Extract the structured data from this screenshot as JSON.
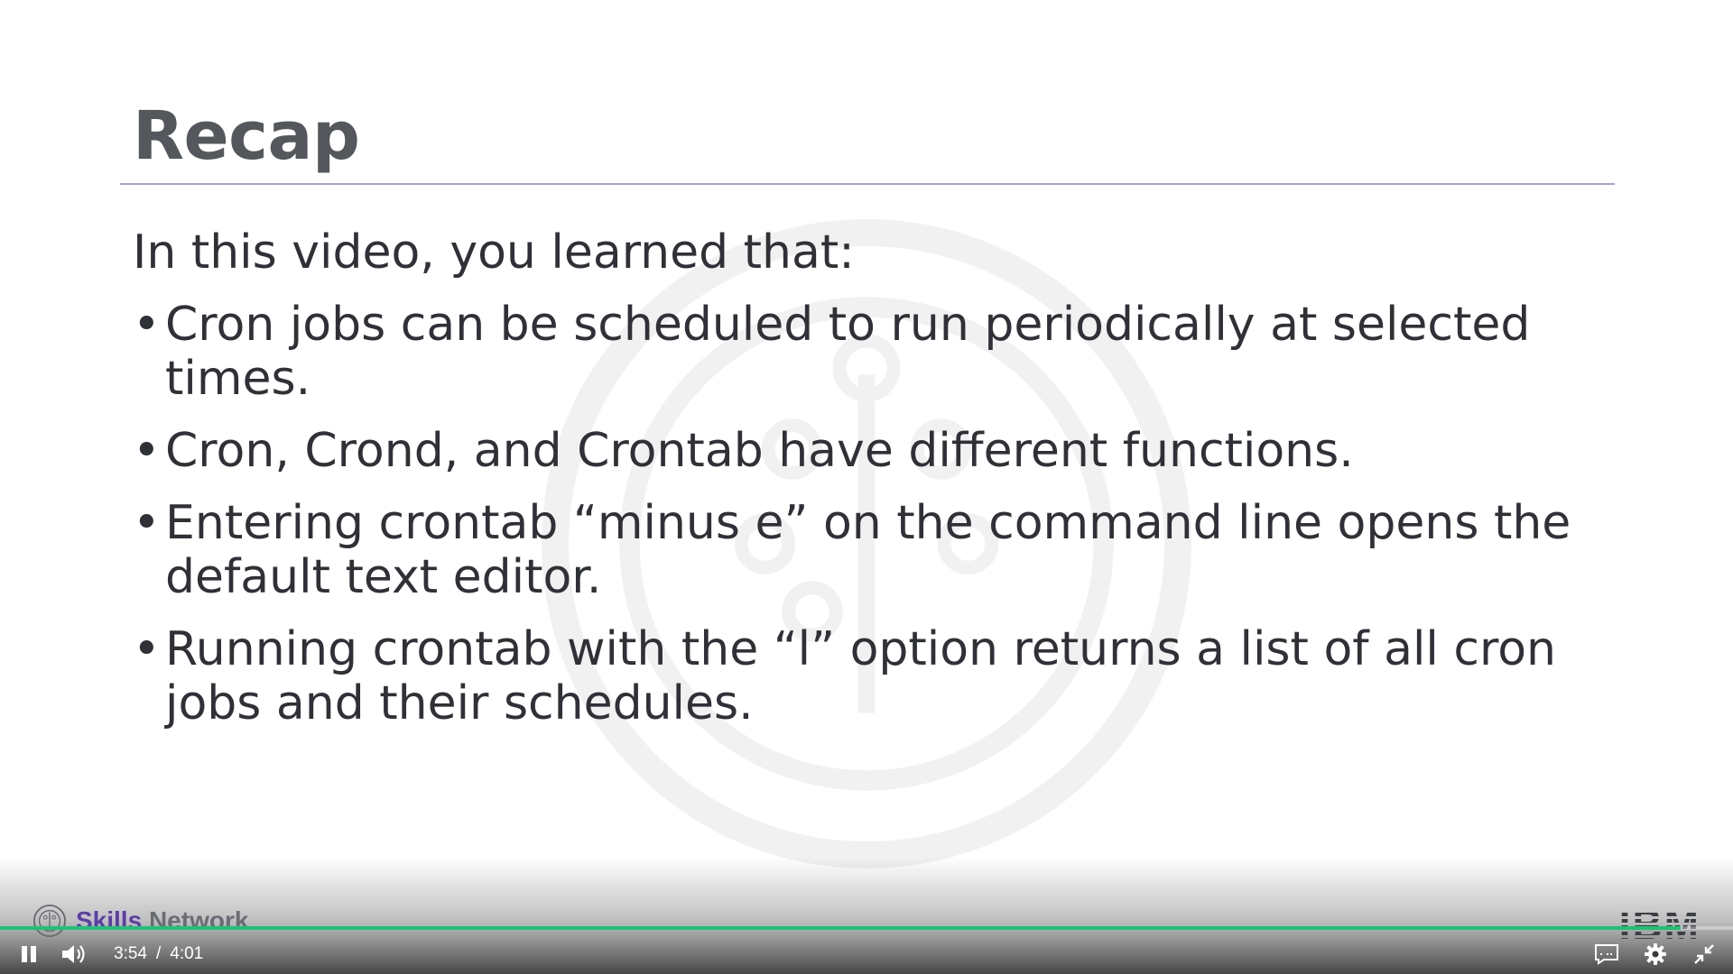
{
  "slide": {
    "title": "Recap",
    "intro": "In this video, you learned that:",
    "bullet_symbol": "•",
    "bullets": [
      "Cron jobs can be scheduled to run periodically at selected times.",
      "Cron, Crond, and Crontab have different functions.",
      "Entering crontab “minus e” on the command line opens the default text editor.",
      "Running crontab with the “l” option returns a list of all cron jobs and their schedules."
    ]
  },
  "branding": {
    "left_logo_word1": "Skills",
    "left_logo_word2": "Network",
    "right_logo": "IBM"
  },
  "player": {
    "current_time": "3:54",
    "separator": "/",
    "duration": "4:01",
    "progress_fraction": 0.97,
    "state": "playing",
    "icons": {
      "play_pause": "pause-icon",
      "volume": "volume-icon",
      "captions": "captions-icon",
      "settings": "gear-icon",
      "exit_fullscreen": "exit-fullscreen-icon"
    },
    "colors": {
      "progress": "#1ec276",
      "controls": "#ffffff"
    }
  },
  "colors": {
    "title": "#54575b",
    "rule": "#a8a3d6",
    "text": "#2f3136",
    "brand_purple": "#5c3ea8"
  }
}
